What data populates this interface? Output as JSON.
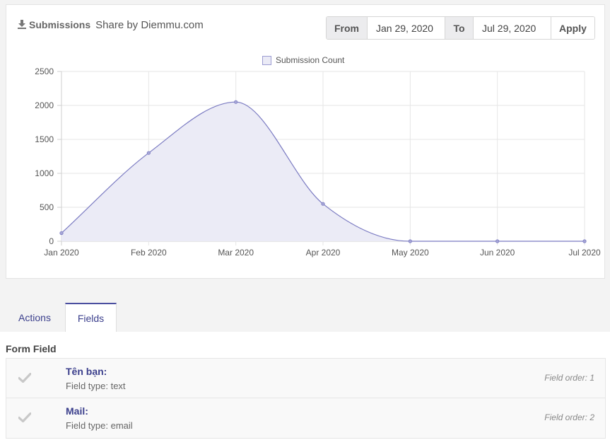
{
  "header": {
    "submissions_label": "Submissions",
    "share_text": "Share by Diemmu.com"
  },
  "date_range": {
    "from_label": "From",
    "from_value": "Jan 29, 2020",
    "to_label": "To",
    "to_value": "Jul 29, 2020",
    "apply_label": "Apply"
  },
  "tabs": [
    {
      "label": "Actions",
      "active": false
    },
    {
      "label": "Fields",
      "active": true
    }
  ],
  "form_field_section": {
    "title": "Form Field",
    "fields": [
      {
        "name": "Tên bạn:",
        "type": "Field type: text",
        "order": "Field order: 1"
      },
      {
        "name": "Mail:",
        "type": "Field type: email",
        "order": "Field order: 2"
      }
    ]
  },
  "chart_data": {
    "type": "area",
    "title": "",
    "xlabel": "",
    "ylabel": "",
    "categories": [
      "Jan 2020",
      "Feb 2020",
      "Mar 2020",
      "Apr 2020",
      "May 2020",
      "Jun 2020",
      "Jul 2020"
    ],
    "series": [
      {
        "name": "Submission Count",
        "values": [
          120,
          1300,
          2050,
          550,
          0,
          0,
          0
        ]
      }
    ],
    "yticks": [
      "0",
      "500",
      "1000",
      "1500",
      "2000",
      "2500"
    ],
    "ylim": [
      0,
      2500
    ],
    "grid": true,
    "legend": "top-center",
    "colors": {
      "line": "#7b7bc2",
      "fill": "#ebebf6"
    }
  }
}
